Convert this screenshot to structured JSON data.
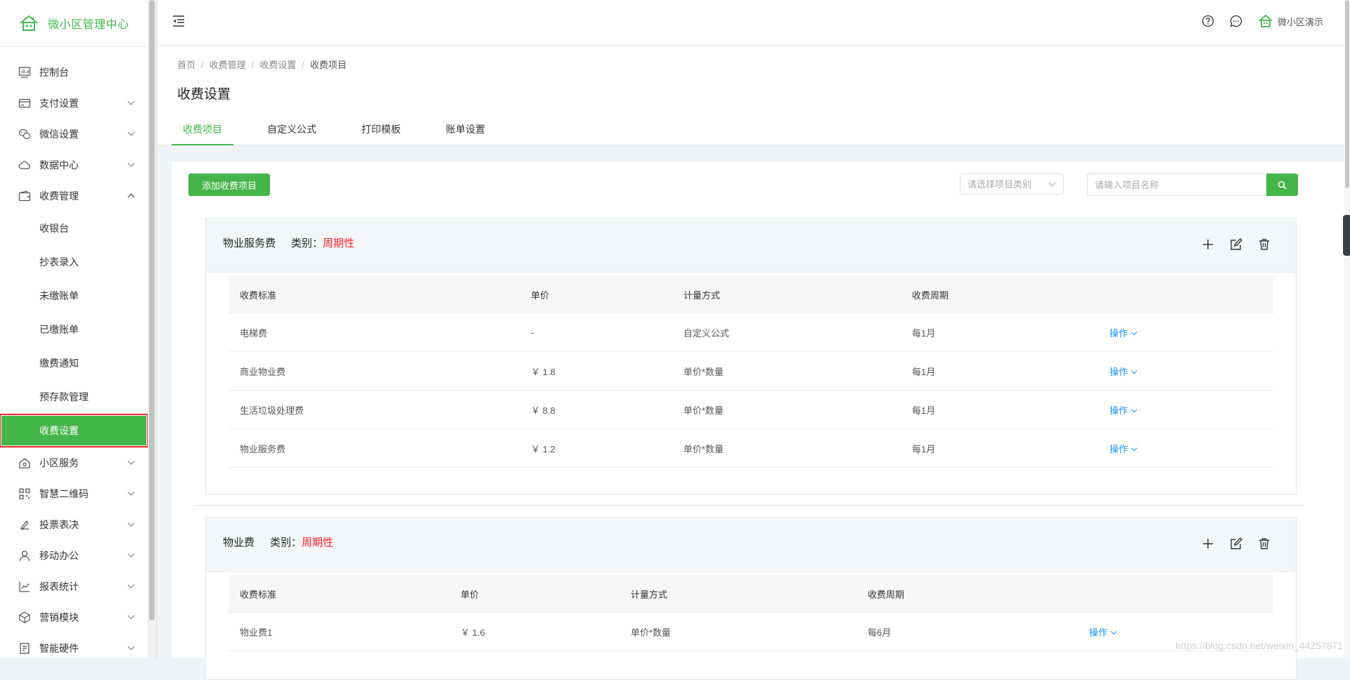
{
  "app": {
    "title": "微小区管理中心"
  },
  "sidebar": {
    "items": [
      {
        "label": "控制台",
        "icon": "dashboard-icon",
        "has_children": false
      },
      {
        "label": "支付设置",
        "icon": "card-icon",
        "has_children": true
      },
      {
        "label": "微信设置",
        "icon": "wechat-icon",
        "has_children": true
      },
      {
        "label": "数据中心",
        "icon": "cloud-icon",
        "has_children": true
      },
      {
        "label": "收费管理",
        "icon": "wallet-icon",
        "has_children": true,
        "expanded": true
      }
    ],
    "submenu": [
      {
        "label": "收银台"
      },
      {
        "label": "抄表录入"
      },
      {
        "label": "未缴账单"
      },
      {
        "label": "已缴账单"
      },
      {
        "label": "缴费通知"
      },
      {
        "label": "预存款管理"
      },
      {
        "label": "收费设置",
        "active": true
      }
    ],
    "items_after": [
      {
        "label": "小区服务",
        "icon": "home-icon"
      },
      {
        "label": "智慧二维码",
        "icon": "qrcode-icon"
      },
      {
        "label": "投票表决",
        "icon": "vote-icon"
      },
      {
        "label": "移动办公",
        "icon": "user-icon"
      },
      {
        "label": "报表统计",
        "icon": "chart-icon"
      },
      {
        "label": "营销模块",
        "icon": "cube-icon"
      },
      {
        "label": "智能硬件",
        "icon": "device-icon"
      }
    ]
  },
  "topbar": {
    "user_name": "微小区演示"
  },
  "breadcrumb": [
    "首页",
    "收费管理",
    "收费设置",
    "收费项目"
  ],
  "page_title": "收费设置",
  "tabs": [
    {
      "label": "收费项目",
      "active": true
    },
    {
      "label": "自定义公式"
    },
    {
      "label": "打印模板"
    },
    {
      "label": "账单设置"
    }
  ],
  "toolbar": {
    "add_label": "添加收费项目",
    "type_placeholder": "请选择项目类别",
    "search_placeholder": "请输入项目名称"
  },
  "groups": [
    {
      "name": "物业服务费",
      "category_label": "类别：",
      "category_value": "周期性",
      "columns": [
        "收费标准",
        "单价",
        "计量方式",
        "收费周期",
        ""
      ],
      "rows": [
        {
          "name": "电梯费",
          "price": "-",
          "method": "自定义公式",
          "cycle": "每1月",
          "op": "操作"
        },
        {
          "name": "商业物业费",
          "price": "￥ 1.8",
          "method": "单价*数量",
          "cycle": "每1月",
          "op": "操作"
        },
        {
          "name": "生活垃圾处理费",
          "price": "￥ 8.8",
          "method": "单价*数量",
          "cycle": "每1月",
          "op": "操作"
        },
        {
          "name": "物业服务费",
          "price": "￥ 1.2",
          "method": "单价*数量",
          "cycle": "每1月",
          "op": "操作"
        }
      ]
    },
    {
      "name": "物业费",
      "category_label": "类别：",
      "category_value": "周期性",
      "columns": [
        "收费标准",
        "单价",
        "计量方式",
        "收费周期",
        ""
      ],
      "rows": [
        {
          "name": "物业费1",
          "price": "￥ 1.6",
          "method": "单价*数量",
          "cycle": "每6月",
          "op": "操作"
        }
      ]
    }
  ],
  "watermark": "https://blog.csdn.net/weixin_44257871",
  "colors": {
    "brand": "#44b549",
    "link": "#1890ff",
    "danger": "#f5222d"
  }
}
